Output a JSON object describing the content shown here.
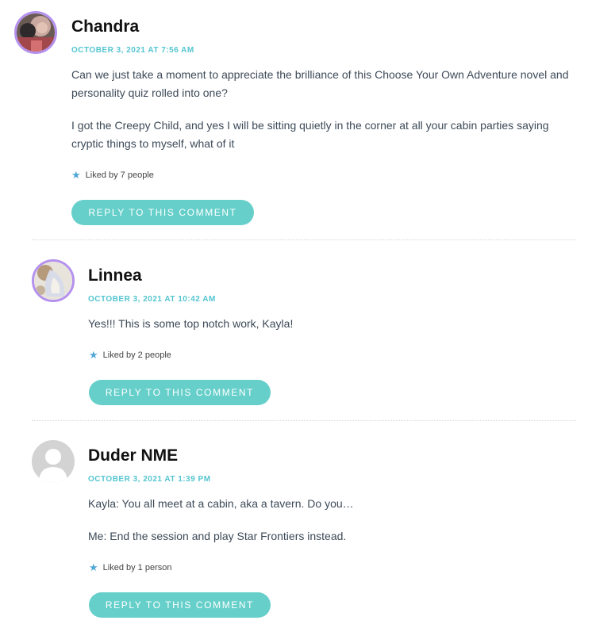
{
  "comments": [
    {
      "author": "Chandra",
      "date": "OCTOBER 3, 2021 AT 7:56 AM",
      "paragraphs": [
        "Can we just take a moment to appreciate the brilliance of this Choose Your Own Adventure novel and personality quiz rolled into one?",
        "I got the Creepy Child, and yes I will be sitting quietly in the corner at all your cabin parties saying cryptic things to myself, what of it"
      ],
      "likes": "Liked by 7 people",
      "reply_label": "REPLY TO THIS COMMENT",
      "avatar_icon": "user-photo-avatar"
    },
    {
      "author": "Linnea",
      "date": "OCTOBER 3, 2021 AT 10:42 AM",
      "paragraphs": [
        "Yes!!! This is some top notch work, Kayla!"
      ],
      "likes": "Liked by 2 people",
      "reply_label": "REPLY TO THIS COMMENT",
      "avatar_icon": "user-photo-avatar"
    },
    {
      "author": "Duder NME",
      "date": "OCTOBER 3, 2021 AT 1:39 PM",
      "paragraphs": [
        "Kayla: You all meet at a cabin, aka a tavern. Do you…",
        "Me: End the session and play Star Frontiers instead."
      ],
      "likes": "Liked by 1 person",
      "reply_label": "REPLY TO THIS COMMENT",
      "avatar_icon": "default-user-avatar"
    }
  ],
  "colors": {
    "accent": "#54c5cf",
    "reply_button": "#66cfca",
    "avatar_ring": "#b591ee",
    "star": "#4fa7d6"
  }
}
